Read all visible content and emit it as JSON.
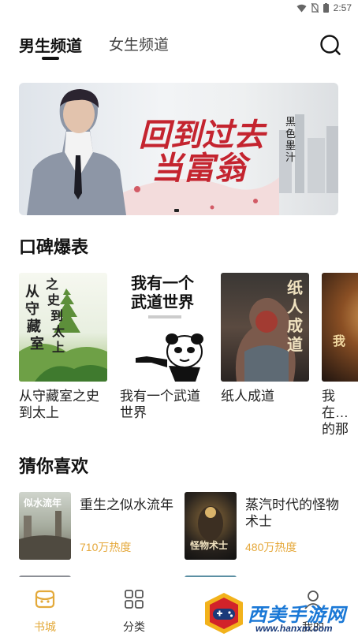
{
  "status_bar": {
    "time": "2:57"
  },
  "header": {
    "tabs": [
      {
        "label": "男生频道",
        "active": true
      },
      {
        "label": "女生频道",
        "active": false
      }
    ]
  },
  "banner": {
    "title_line1": "回到过去",
    "title_line2": "当富翁",
    "author": "黑色墨汁"
  },
  "sections": {
    "praise_title": "口碑爆表",
    "guess_title": "猜你喜欢"
  },
  "praise_books": [
    {
      "title": "从守藏室之史到太上",
      "cover_text": "从守藏室之史到太上"
    },
    {
      "title": "我有一个武道世界",
      "cover_text": "我有一个武道世界"
    },
    {
      "title": "纸人成道",
      "cover_text": "纸人成道"
    },
    {
      "title": "我在…的那",
      "cover_text": "我在"
    }
  ],
  "guess_books": [
    {
      "title": "重生之似水流年",
      "heat": "710万热度",
      "cover_text": "似水流年"
    },
    {
      "title": "蒸汽时代的怪物术士",
      "heat": "480万热度",
      "cover_text": "怪物术士"
    }
  ],
  "bottom_nav": [
    {
      "label": "书城",
      "icon": "bookstore-icon",
      "active": true
    },
    {
      "label": "分类",
      "icon": "category-icon",
      "active": false
    },
    {
      "label": "我的",
      "icon": "profile-icon",
      "active": false
    }
  ],
  "watermark": {
    "text": "西美手游网",
    "url": "www.hanxm.com"
  },
  "colors": {
    "accent": "#e3a93a",
    "banner_red": "#c4242f",
    "watermark_blue": "#1a78d6"
  }
}
